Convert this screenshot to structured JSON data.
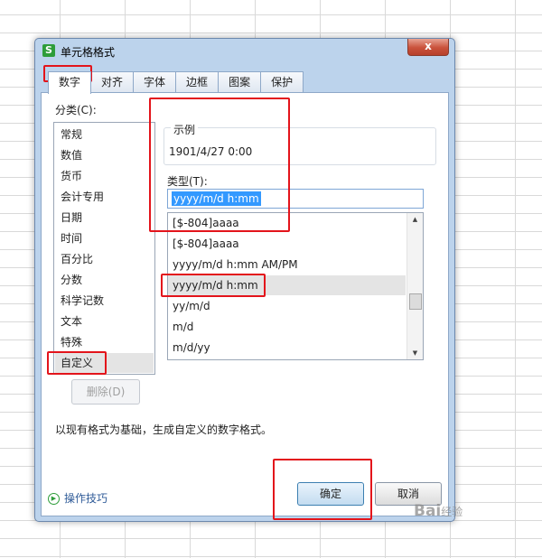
{
  "dialog": {
    "title": "单元格格式",
    "app_icon": "S",
    "close": "x",
    "tabs": [
      "数字",
      "对齐",
      "字体",
      "边框",
      "图案",
      "保护"
    ],
    "category_label": "分类(C):",
    "categories": [
      "常规",
      "数值",
      "货币",
      "会计专用",
      "日期",
      "时间",
      "百分比",
      "分数",
      "科学记数",
      "文本",
      "特殊",
      "自定义"
    ],
    "selected_category": "自定义",
    "delete_button": "删除(D)",
    "sample": {
      "title": "示例",
      "value": "1901/4/27 0:00"
    },
    "type_label": "类型(T):",
    "type_value": "yyyy/m/d h:mm",
    "type_options": [
      "[$-804]aaaa",
      "[$-804]aaaa",
      "yyyy/m/d h:mm AM/PM",
      "yyyy/m/d h:mm",
      "yy/m/d",
      "m/d",
      "m/d/yy"
    ],
    "selected_type": "yyyy/m/d h:mm",
    "description": "以现有格式为基础，生成自定义的数字格式。",
    "tips": "操作技巧",
    "ok_button": "确定",
    "cancel_button": "取消"
  },
  "watermark": {
    "brand": "Bai",
    "sub": "经验"
  },
  "colors": {
    "highlight_box": "#e3141b",
    "selection": "#3399ff",
    "close_button": "#c9513b"
  },
  "icons": [
    "app-logo-icon",
    "close-icon",
    "scroll-up-icon",
    "scroll-down-icon",
    "tips-play-icon"
  ]
}
